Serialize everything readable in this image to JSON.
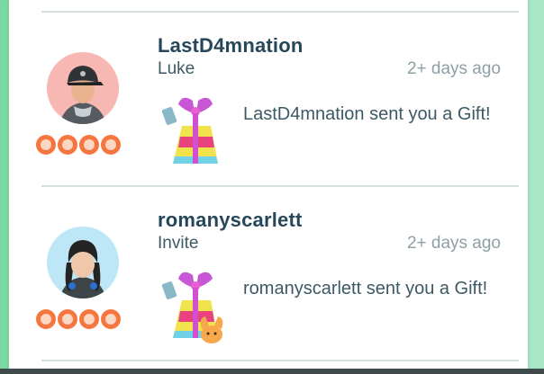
{
  "friends": [
    {
      "username": "LastD4mnation",
      "subtitle": "Luke",
      "time": "2+ days ago",
      "message": "LastD4mnation sent you a Gift!"
    },
    {
      "username": "romanyscarlett",
      "subtitle": "Invite",
      "time": "2+ days ago",
      "message": "romanyscarlett sent you a Gift!"
    }
  ],
  "colors": {
    "background": "#8fe0b3",
    "name": "#26475a",
    "time": "#8e9fa6",
    "heart": "#f5763e"
  }
}
